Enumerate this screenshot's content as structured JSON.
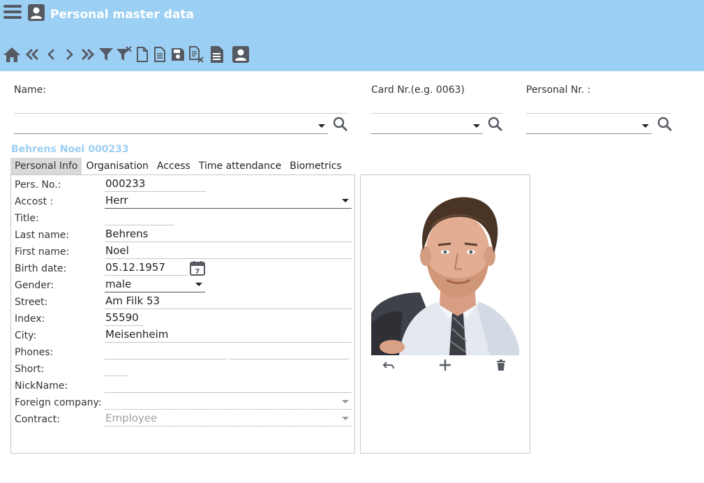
{
  "header": {
    "title": "Personal master data",
    "menu_icon": "hamburger-menu-icon",
    "person_icon": "person-card-icon",
    "background": "#9ccff4"
  },
  "toolbar": {
    "icons": [
      "home-icon",
      "first-record-icon",
      "previous-record-icon",
      "next-record-icon",
      "last-record-icon",
      "filter-icon",
      "clear-filter-icon",
      "new-document-icon",
      "document-list-icon",
      "save-icon",
      "delete-document-icon",
      "report-icon",
      "person-card-icon"
    ],
    "icon_color": "#555a62"
  },
  "search": {
    "name_label": "Name:",
    "name_value": "",
    "card_label": "Card Nr.(e.g. 0063)",
    "card_value": "",
    "persnr_label": "Personal Nr. :",
    "persnr_value": ""
  },
  "person": {
    "heading": "Behrens Noel 000233"
  },
  "tabs": [
    {
      "label": "Personal Info",
      "active": true
    },
    {
      "label": "Organisation",
      "active": false
    },
    {
      "label": "Access",
      "active": false
    },
    {
      "label": "Time attendance",
      "active": false
    },
    {
      "label": "Biometrics",
      "active": false
    }
  ],
  "form": {
    "pers_no": {
      "label": "Pers. No.:",
      "value": "000233"
    },
    "accost": {
      "label": "Accost :",
      "value": "Herr"
    },
    "title": {
      "label": "Title:",
      "value": ""
    },
    "last_name": {
      "label": "Last name:",
      "value": "Behrens"
    },
    "first_name": {
      "label": "First name:",
      "value": "Noel"
    },
    "birth_date": {
      "label": "Birth date:",
      "value": "05.12.1957",
      "calendar_day": "7"
    },
    "gender": {
      "label": "Gender:",
      "value": "male"
    },
    "street": {
      "label": "Street:",
      "value": "Am Filk 53"
    },
    "index": {
      "label": "Index:",
      "value": "55590"
    },
    "city": {
      "label": "City:",
      "value": "Meisenheim"
    },
    "phones": {
      "label": "Phones:",
      "value1": "",
      "value2": ""
    },
    "short": {
      "label": "Short:",
      "value": ""
    },
    "nickname": {
      "label": "NickName:",
      "value": ""
    },
    "foreign_company": {
      "label": "Foreign company:",
      "value": ""
    },
    "contract": {
      "label": "Contract:",
      "value": "Employee"
    }
  },
  "photo": {
    "actions": [
      "undo-icon",
      "add-icon",
      "trash-icon"
    ]
  }
}
